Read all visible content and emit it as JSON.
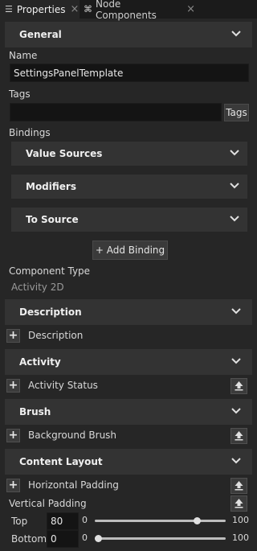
{
  "tabs": [
    {
      "label": "Properties",
      "icon": "list-icon",
      "active": true
    },
    {
      "label": "Node Components",
      "icon": "components-icon",
      "active": false
    }
  ],
  "general": {
    "title": "General",
    "name_label": "Name",
    "name_value": "SettingsPanelTemplate",
    "tags_label": "Tags",
    "tags_value": "",
    "tags_button": "Tags",
    "bindings_label": "Bindings",
    "bindings": [
      "Value Sources",
      "Modifiers",
      "To Source"
    ],
    "add_binding": "+ Add Binding",
    "component_type_label": "Component Type",
    "component_type_value": "Activity 2D"
  },
  "description": {
    "title": "Description",
    "property": "Description"
  },
  "activity": {
    "title": "Activity",
    "property": "Activity Status"
  },
  "brush": {
    "title": "Brush",
    "property": "Background Brush"
  },
  "content_layout": {
    "title": "Content Layout",
    "horizontal_padding": "Horizontal Padding",
    "vertical_padding": "Vertical Padding",
    "top_label": "Top",
    "top_value": "80",
    "top_min": "0",
    "top_max": "100",
    "top_level": 0.8,
    "bottom_label": "Bottom",
    "bottom_value": "0",
    "bottom_min": "0",
    "bottom_max": "100",
    "bottom_level": 0.0
  },
  "colors": {
    "panel_bg": "#262626",
    "section_bg": "#333333",
    "field_bg": "#141414"
  }
}
